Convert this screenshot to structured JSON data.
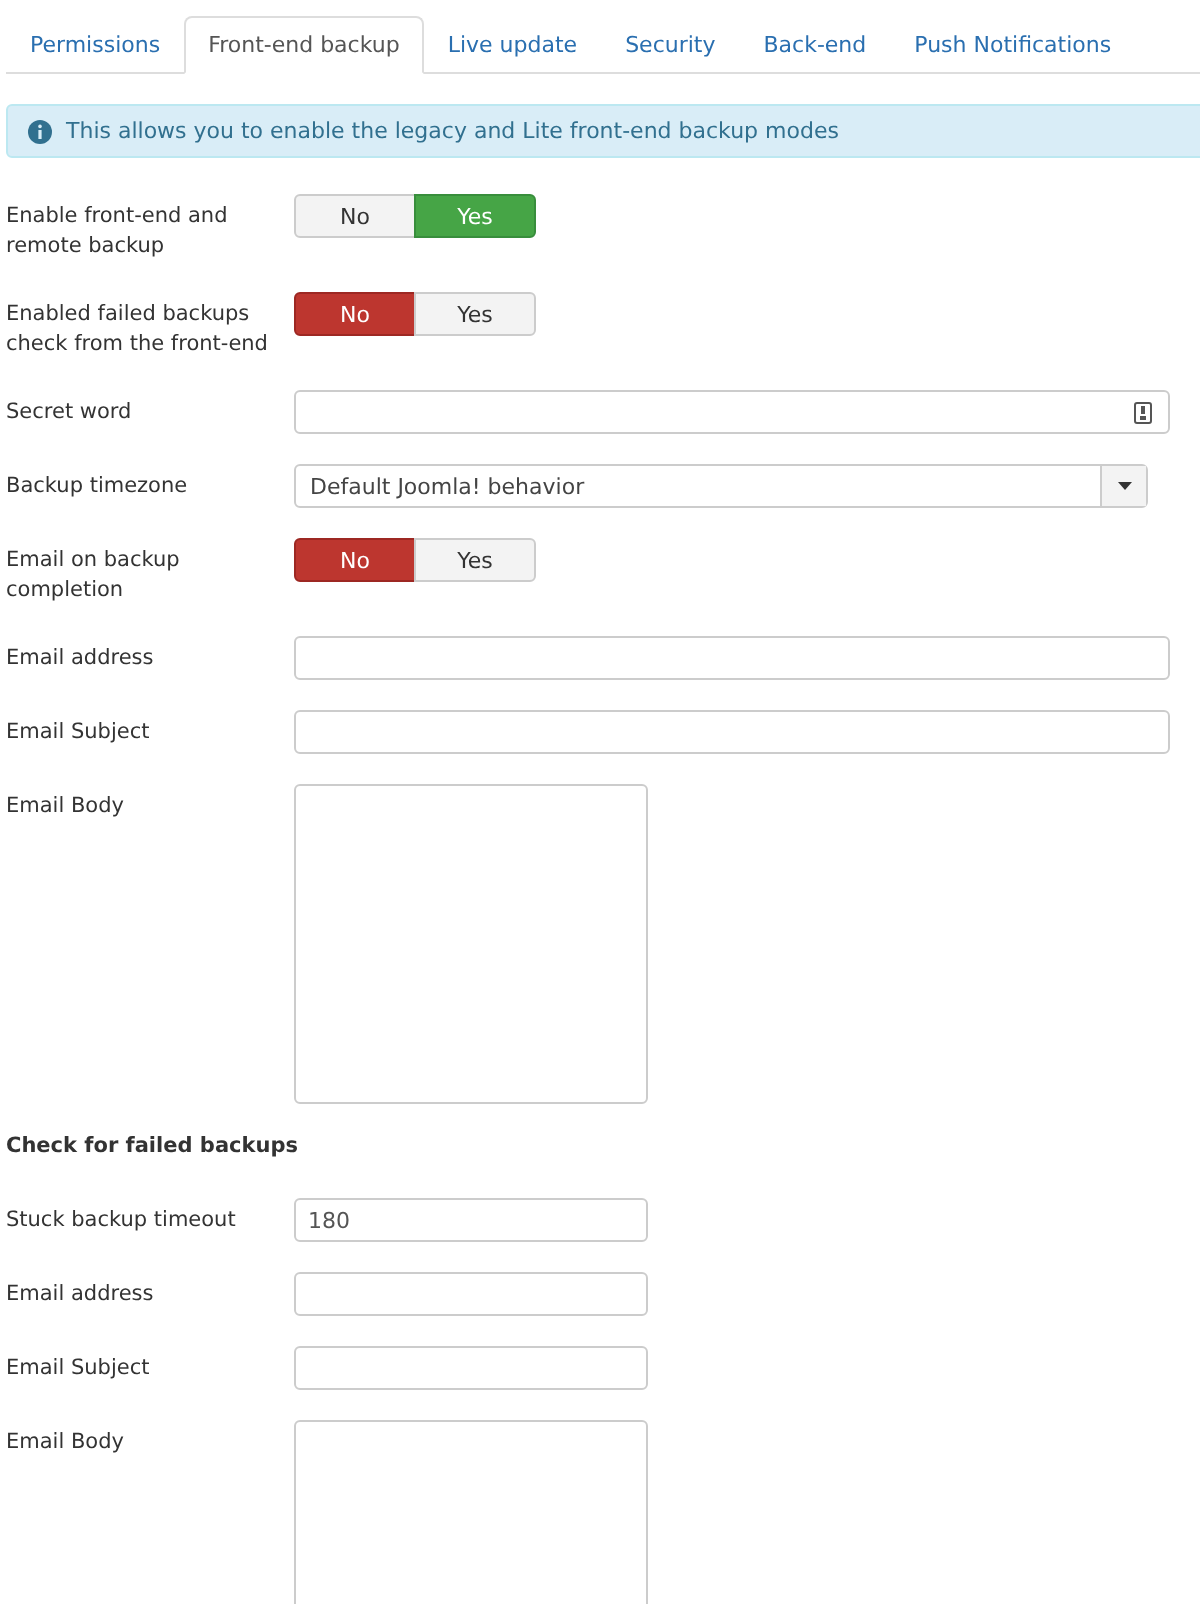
{
  "tabs": [
    {
      "label": "Permissions",
      "selected": false
    },
    {
      "label": "Front-end backup",
      "selected": true
    },
    {
      "label": "Live update",
      "selected": false
    },
    {
      "label": "Security",
      "selected": false
    },
    {
      "label": "Back-end",
      "selected": false
    },
    {
      "label": "Push Notifications",
      "selected": false
    }
  ],
  "alert": {
    "text": "This allows you to enable the legacy and Lite front-end backup modes"
  },
  "fields": [
    {
      "kind": "toggle",
      "label": "Enable front-end and remote backup",
      "options": [
        {
          "label": "No",
          "selected": false
        },
        {
          "label": "Yes",
          "selected": true
        }
      ]
    },
    {
      "kind": "toggle",
      "label": "Enabled failed backups check from the front-end",
      "options": [
        {
          "label": "No",
          "selected": true
        },
        {
          "label": "Yes",
          "selected": false
        }
      ]
    },
    {
      "kind": "secret",
      "label": "Secret word"
    },
    {
      "kind": "select",
      "label": "Backup timezone",
      "value": "Default Joomla! behavior"
    },
    {
      "kind": "toggle",
      "label": "Email on backup completion",
      "options": [
        {
          "label": "No",
          "selected": true
        },
        {
          "label": "Yes",
          "selected": false
        }
      ]
    },
    {
      "kind": "text",
      "label": "Email address"
    },
    {
      "kind": "text",
      "label": "Email Subject"
    },
    {
      "kind": "textarea",
      "label": "Email Body"
    },
    {
      "kind": "heading",
      "label": "Check for failed backups"
    },
    {
      "kind": "short",
      "label": "Stuck backup timeout",
      "value": "180"
    },
    {
      "kind": "short",
      "label": "Email address"
    },
    {
      "kind": "short",
      "label": "Email Subject"
    },
    {
      "kind": "textarea",
      "label": "Email Body"
    }
  ]
}
